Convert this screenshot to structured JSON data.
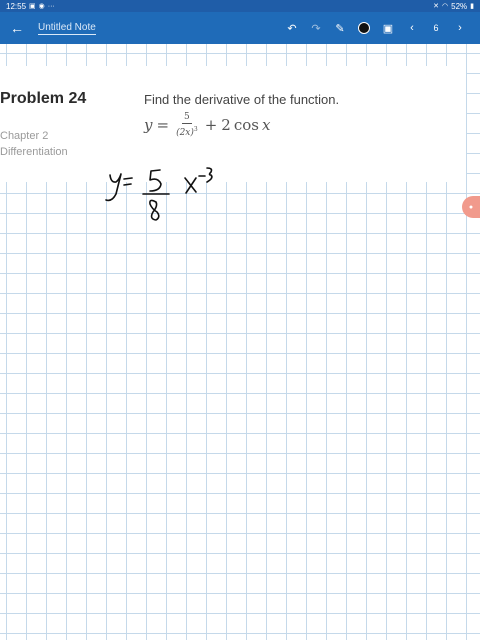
{
  "status_bar": {
    "time": "12:55",
    "battery": "52%",
    "more": "···"
  },
  "toolbar": {
    "back_icon": "←",
    "note_title": "Untitled Note",
    "undo_icon": "↶",
    "redo_icon": "↷",
    "pen_icon": "✎",
    "pen_color": "#111111",
    "image_icon": "▣",
    "prev_icon": "‹",
    "page_number": "6",
    "next_icon": "›"
  },
  "problem": {
    "title": "Problem 24",
    "chapter": "Chapter 2",
    "section": "Differentiation",
    "instruction": "Find the derivative of the function.",
    "formula": {
      "lhs": "y",
      "equals": "=",
      "numerator": "5",
      "denominator_base": "(2x)",
      "denominator_exponent": "3",
      "plus": "+",
      "coefficient": "2",
      "function": "cos",
      "variable": "x"
    }
  },
  "side_badge": {
    "color": "#f19a8c"
  }
}
